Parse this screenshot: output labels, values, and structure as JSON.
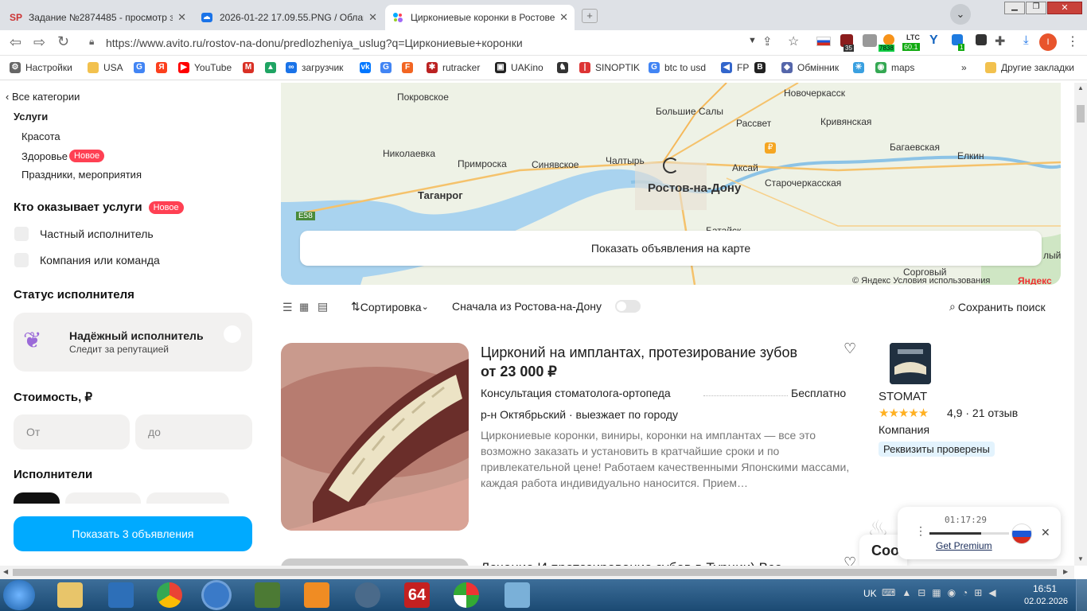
{
  "browser": {
    "tabs": [
      {
        "favicon": "SP",
        "title": "Задание №2874485 - просмотр з"
      },
      {
        "favicon": "cloud-icon",
        "title": "2026-01-22 17.09.55.PNG / Облак"
      },
      {
        "favicon": "avito-icon",
        "title": "Циркониевые коронки в Ростове"
      }
    ],
    "new_tab": "+",
    "url": "https://www.avito.ru/rostov-na-donu/predlozheniya_uslug?q=Циркониевые+коронки",
    "ext_ltc_label": "LTC",
    "ext_ltc_value": "60.1",
    "ext_badge_1": "35",
    "ext_badge_2": "7838",
    "ext_badge_3": "1",
    "profile_letter": "I",
    "bookmarks": [
      {
        "label": "Настройки",
        "icon": "gear-icon",
        "color": "#666"
      },
      {
        "label": "USA",
        "icon": "folder-icon",
        "color": "#f2c14e"
      },
      {
        "label": "",
        "icon": "google-icon",
        "color": "#4285f4"
      },
      {
        "label": "",
        "icon": "yandex-icon",
        "color": "#fc3f1d"
      },
      {
        "label": "YouTube",
        "icon": "youtube-icon",
        "color": "#ff0000"
      },
      {
        "label": "",
        "icon": "gmail-icon",
        "color": "#d93025"
      },
      {
        "label": "",
        "icon": "drive-icon",
        "color": "#1fa463"
      },
      {
        "label": "загрузчик",
        "icon": "loader-icon",
        "color": "#1a73e8"
      },
      {
        "label": "",
        "icon": "vk-icon",
        "color": "#0077ff"
      },
      {
        "label": "",
        "icon": "translate-icon",
        "color": "#4285f4"
      },
      {
        "label": "",
        "icon": "f-icon",
        "color": "#f26522"
      },
      {
        "label": "rutracker",
        "icon": "rutracker-icon",
        "color": "#b22"
      },
      {
        "label": "UAKino",
        "icon": "uakino-icon",
        "color": "#222"
      },
      {
        "label": "",
        "icon": "man-icon",
        "color": "#333"
      },
      {
        "label": "SINOPTIK",
        "icon": "thermometer-icon",
        "color": "#d33"
      },
      {
        "label": "btc to usd",
        "icon": "google-icon",
        "color": "#4285f4"
      },
      {
        "label": "FP",
        "icon": "fp-icon",
        "color": "#3366cc"
      },
      {
        "label": "",
        "icon": "bc-icon",
        "color": "#222"
      },
      {
        "label": "Обмінник",
        "icon": "exchange-icon",
        "color": "#5566aa"
      },
      {
        "label": "",
        "icon": "star-icon",
        "color": "#3aa0e0"
      },
      {
        "label": "maps",
        "icon": "maps-icon",
        "color": "#34a853"
      }
    ],
    "bookmarks_more": "»",
    "other_bookmarks": "Другие закладки"
  },
  "sidebar": {
    "all_categories": "Все категории",
    "category": "Услуги",
    "subcategories": [
      "Красота",
      "Здоровье",
      "Праздники, мероприятия"
    ],
    "badge_new": "Новое",
    "provider_title": "Кто оказывает услуги",
    "provider_options": [
      "Частный исполнитель",
      "Компания или команда"
    ],
    "status_title": "Статус исполнителя",
    "reliable_title": "Надёжный исполнитель",
    "reliable_sub": "Следит за репутацией",
    "price_title": "Стоимость, ₽",
    "price_from": "От",
    "price_to": "до",
    "performers_title": "Исполнители",
    "show_button": "Показать 3 объявления"
  },
  "map": {
    "labels": [
      "Покровское",
      "Новочеркасск",
      "Большие Салы",
      "Рассвет",
      "Кривянская",
      "Николаевка",
      "Примроска",
      "Синявское",
      "Чалтырь",
      "Аксай",
      "Багаевская",
      "Елкин",
      "Таганрог",
      "Ростов-на-Дону",
      "Старочеркасская",
      "E58",
      "Батайск",
      "Сорговый",
      "лый"
    ],
    "show_on_map": "Показать объявления на карте",
    "copyright": "© Яндекс Условия использования",
    "yandex_logo": "Яндекс"
  },
  "toolbar": {
    "sort": "Сортировка",
    "rostov_first": "Сначала из Ростова-на-Дону",
    "save_search": "Сохранить поиск"
  },
  "listing": {
    "title": "Цирконий на имплантах, протезирование зубов",
    "price": "от 23 000 ₽",
    "service": "Консультация стоматолога-ортопеда",
    "service_price": "Бесплатно",
    "location": "р-н Октябрьский · выезжает по городу",
    "description": "Циркониевые коронки, виниры, коронки на имплантах — все это возможно заказать и установить в кратчайшие сроки и по привлекательной цене! Работаем качественными Японскими массами, каждая работа индивидуально наносится. Прием…",
    "seller": "STOMAT",
    "rating": 4.9,
    "rating_text": "4,9 · 21 отзыв",
    "seller_type": "Компания",
    "verified": "Реквизиты проверены",
    "stars": "★★★★★",
    "next_title": "Лечение И протезирование зубов в Турции) Все"
  },
  "widget": {
    "timer": "01:17:29",
    "premium": "Get Premium",
    "progress": 0.65
  },
  "chat_peek": "Coo",
  "taskbar": {
    "lang": "UK",
    "time": "16:51",
    "date": "02.02.2026",
    "app_64": "64"
  }
}
